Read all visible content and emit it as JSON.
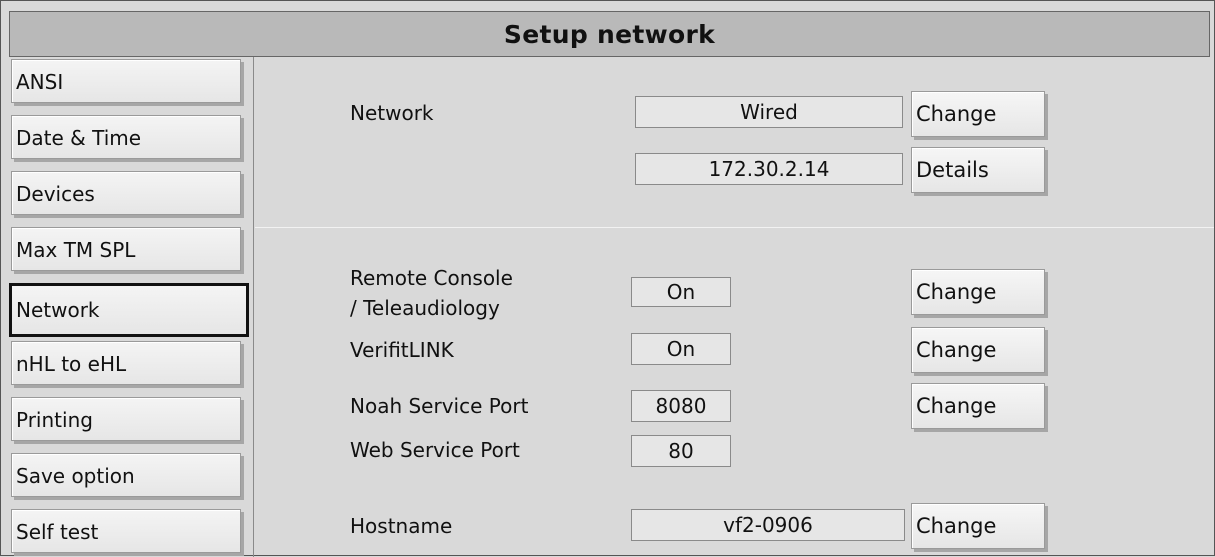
{
  "title": "Setup network",
  "sidebar": {
    "items": [
      {
        "label": "ANSI"
      },
      {
        "label": "Date & Time"
      },
      {
        "label": "Devices"
      },
      {
        "label": "Max TM SPL"
      },
      {
        "label": "Network",
        "selected": true
      },
      {
        "label": "nHL to eHL"
      },
      {
        "label": "Printing"
      },
      {
        "label": "Save option"
      },
      {
        "label": "Self test"
      }
    ]
  },
  "network": {
    "label": "Network",
    "value": "Wired",
    "change_label": "Change",
    "ip": "172.30.2.14",
    "details_label": "Details"
  },
  "settings": {
    "remote_console": {
      "label_line1": "Remote Console",
      "label_line2": "/ Teleaudiology",
      "value": "On",
      "button": "Change"
    },
    "verifitlink": {
      "label": "VerifitLINK",
      "value": "On",
      "button": "Change"
    },
    "noah_port": {
      "label": "Noah Service Port",
      "value": "8080",
      "button": "Change"
    },
    "web_port": {
      "label": "Web Service Port",
      "value": "80"
    },
    "hostname": {
      "label": "Hostname",
      "value": "vf2-0906",
      "button": "Change"
    }
  }
}
